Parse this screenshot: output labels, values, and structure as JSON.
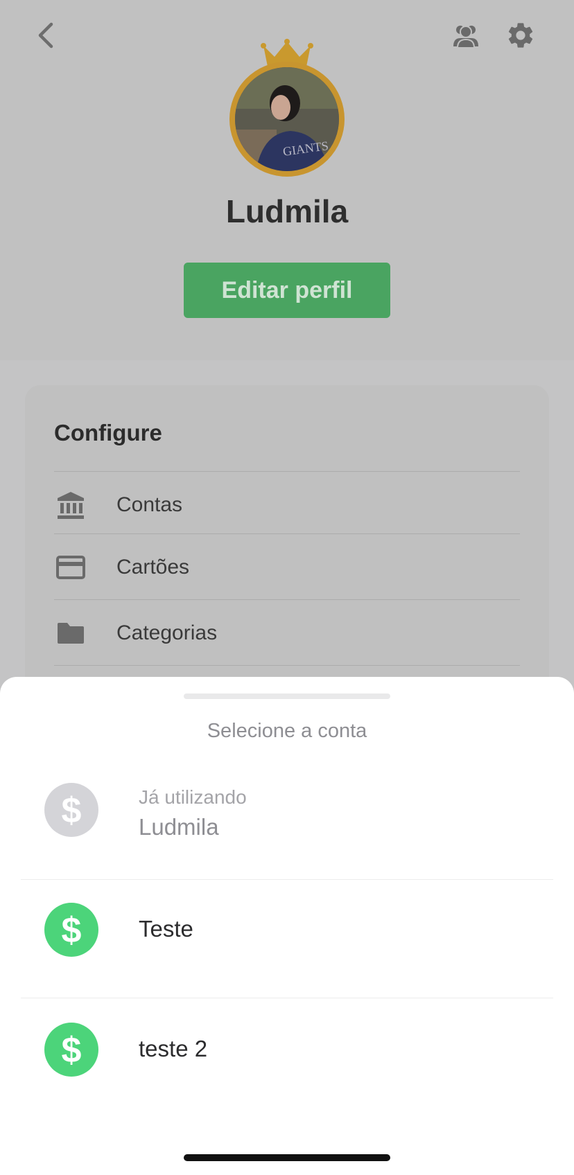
{
  "profile": {
    "name": "Ludmila",
    "edit_button": "Editar perfil"
  },
  "header_icons": {
    "back": "chevron-left-icon",
    "group": "group-users-icon",
    "settings": "gear-icon"
  },
  "configure": {
    "title": "Configure",
    "items": [
      {
        "label": "Contas",
        "icon": "bank-icon"
      },
      {
        "label": "Cartões",
        "icon": "credit-card-icon"
      },
      {
        "label": "Categorias",
        "icon": "folder-icon"
      }
    ]
  },
  "sheet": {
    "title": "Selecione a conta",
    "accounts": [
      {
        "subtitle": "Já utilizando",
        "name": "Ludmila",
        "icon": "dollar-icon",
        "color": "#d4d4d8",
        "current": true
      },
      {
        "name": "Teste",
        "icon": "dollar-icon",
        "color": "#4cd47a"
      },
      {
        "name": "teste 2",
        "icon": "dollar-icon",
        "color": "#4cd47a"
      }
    ]
  },
  "colors": {
    "accent_green": "#4aa461",
    "crown_gold": "#d4a12a",
    "account_green": "#4cd47a"
  }
}
